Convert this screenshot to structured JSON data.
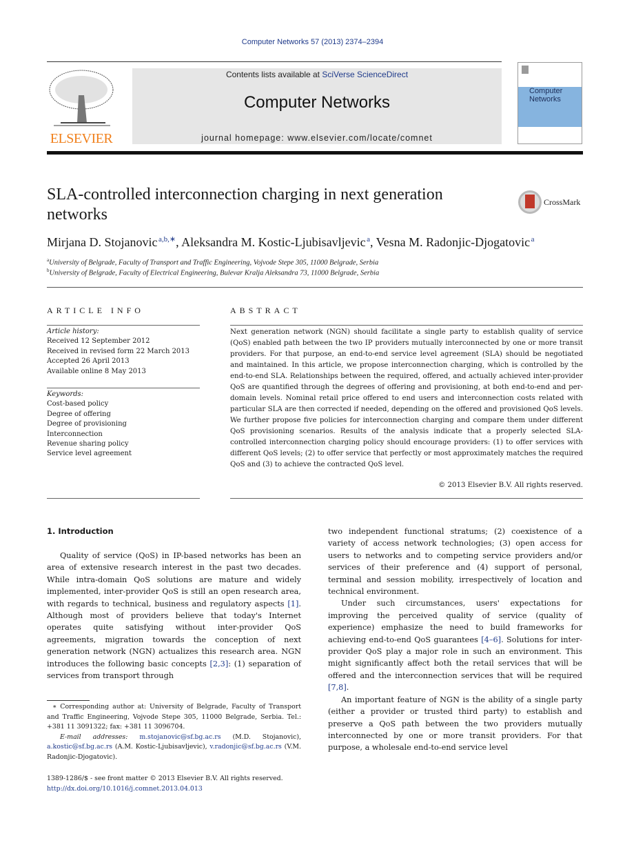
{
  "journal_ref": "Computer Networks 57 (2013) 2374–2394",
  "header": {
    "publisher_logo_text": "ELSEVIER",
    "contents_prefix": "Contents lists available at ",
    "contents_link": "SciVerse ScienceDirect",
    "journal_title": "Computer Networks",
    "homepage": "journal homepage: www.elsevier.com/locate/comnet",
    "cover_title_line1": "Computer",
    "cover_title_line2": "Networks"
  },
  "colors": {
    "link": "#1f3a8a",
    "elsevier_orange": "#f07f1a",
    "banner_bg": "#e6e6e6",
    "cover_blue": "#86b4df"
  },
  "article": {
    "title": "SLA-controlled interconnection charging in next generation networks",
    "crossmark_label": "CrossMark",
    "authors": [
      {
        "name": "Mirjana D. Stojanovic",
        "sup": "a,b,∗"
      },
      {
        "name": "Aleksandra M. Kostic-Ljubisavljevic",
        "sup": "a"
      },
      {
        "name": "Vesna M. Radonjic-Djogatovic",
        "sup": "a"
      }
    ],
    "affiliations": [
      {
        "mark": "a",
        "text": "University of Belgrade, Faculty of Transport and Traffic Engineering, Vojvode Stepe 305, 11000 Belgrade, Serbia"
      },
      {
        "mark": "b",
        "text": "University of Belgrade, Faculty of Electrical Engineering, Bulevar Kralja Aleksandra 73, 11000 Belgrade, Serbia"
      }
    ]
  },
  "article_info": {
    "heading": "ARTICLE INFO",
    "history_label": "Article history:",
    "history": [
      "Received 12 September 2012",
      "Received in revised form 22 March 2013",
      "Accepted 26 April 2013",
      "Available online 8 May 2013"
    ],
    "keywords_label": "Keywords:",
    "keywords": [
      "Cost-based policy",
      "Degree of offering",
      "Degree of provisioning",
      "Interconnection",
      "Revenue sharing policy",
      "Service level agreement"
    ]
  },
  "abstract": {
    "heading": "ABSTRACT",
    "text": "Next generation network (NGN) should facilitate a single party to establish quality of service (QoS) enabled path between the two IP providers mutually interconnected by one or more transit providers. For that purpose, an end-to-end service level agreement (SLA) should be negotiated and maintained. In this article, we propose interconnection charging, which is controlled by the end-to-end SLA. Relationships between the required, offered, and actually achieved inter-provider QoS are quantified through the degrees of offering and provisioning, at both end-to-end and per-domain levels. Nominal retail price offered to end users and interconnection costs related with particular SLA are then corrected if needed, depending on the offered and provisioned QoS levels. We further propose five policies for interconnection charging and compare them under different QoS provisioning scenarios. Results of the analysis indicate that a properly selected SLA-controlled interconnection charging policy should encourage providers: (1) to offer services with different QoS levels; (2) to offer service that perfectly or most approximately matches the required QoS and (3) to achieve the contracted QoS level.",
    "copyright": "© 2013 Elsevier B.V. All rights reserved."
  },
  "body": {
    "intro_heading": "1. Introduction",
    "left_p1_a": "Quality of service (QoS) in IP-based networks has been an area of extensive research interest in the past two decades. While intra-domain QoS solutions are mature and widely implemented, inter-provider QoS is still an open research area, with regards to technical, business and regulatory aspects ",
    "left_ref1": "[1]",
    "left_p1_b": ". Although most of providers believe that today's Internet operates quite satisfying without inter-provider QoS agreements, migration towards the conception of next generation network (NGN) actualizes this research area. NGN introduces the following basic concepts ",
    "left_ref2": "[2,3]",
    "left_p1_c": ": (1) separation of services from transport through",
    "right_p1": "two independent functional stratums; (2) coexistence of a variety of access network technologies; (3) open access for users to networks and to competing service providers and/or services of their preference and (4) support of personal, terminal and session mobility, irrespectively of location and technical environment.",
    "right_p2_a": "Under such circumstances, users' expectations for improving the perceived quality of service (quality of experience) emphasize the need to build frameworks for achieving end-to-end QoS guarantees ",
    "right_ref1": "[4–6]",
    "right_p2_b": ". Solutions for inter-provider QoS play a major role in such an environment. This might significantly affect both the retail services that will be offered and the interconnection services that will be required ",
    "right_ref2": "[7,8]",
    "right_p2_c": ".",
    "right_p3": "An important feature of NGN is the ability of a single party (either a provider or trusted third party) to establish and preserve a QoS path between the two providers mutually interconnected by one or more transit providers. For that purpose, a wholesale end-to-end service level"
  },
  "footnotes": {
    "corresponding": "∗ Corresponding author at: University of Belgrade, Faculty of Transport and Traffic Engineering, Vojvode Stepe 305, 11000 Belgrade, Serbia. Tel.: +381 11 3091322; fax: +381 11 3096704.",
    "email_label": "E-mail addresses:",
    "emails": [
      {
        "address": "m.stojanovic@sf.bg.ac.rs",
        "owner": "(M.D. Stojanovic),"
      },
      {
        "address": "a.kostic@sf.bg.ac.rs",
        "owner": "(A.M. Kostic-Ljubisavljevic),"
      },
      {
        "address": "v.radonjic@sf.bg.ac.rs",
        "owner": "(V.M. Radonjic-Djogatovic)."
      }
    ],
    "front_matter": "1389-1286/$ - see front matter © 2013 Elsevier B.V. All rights reserved.",
    "doi": "http://dx.doi.org/10.1016/j.comnet.2013.04.013"
  }
}
